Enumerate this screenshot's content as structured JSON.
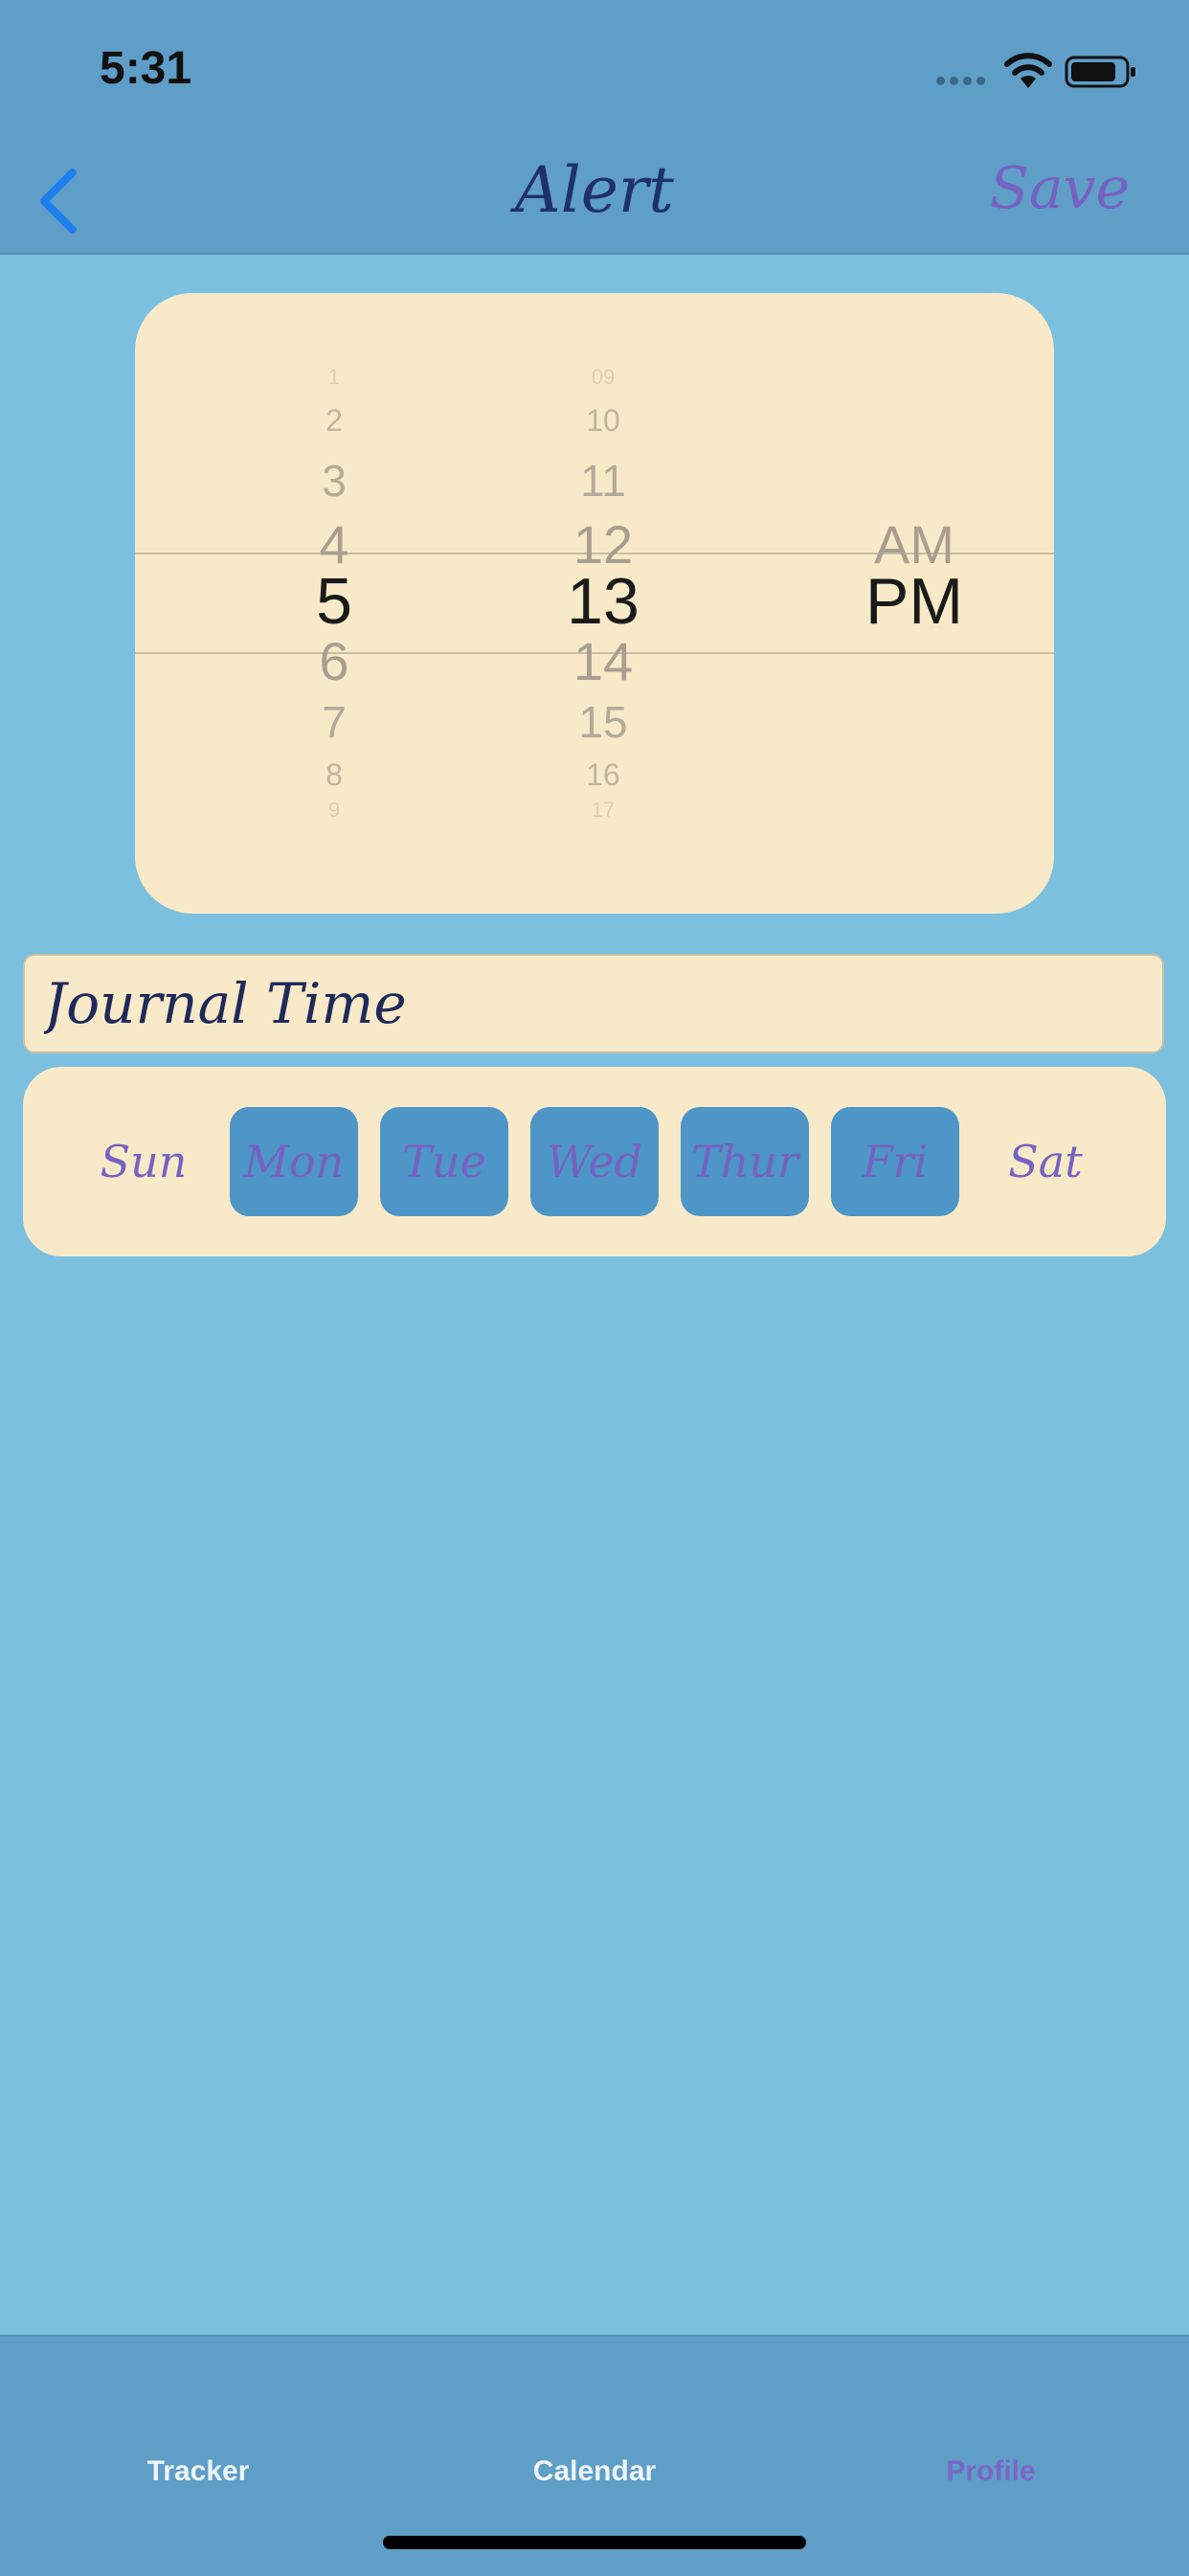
{
  "status": {
    "time": "5:31"
  },
  "nav": {
    "title": "Alert",
    "save_label": "Save"
  },
  "picker": {
    "hours": [
      "1",
      "2",
      "3",
      "4",
      "5",
      "6",
      "7",
      "8",
      "9"
    ],
    "selected_hour": "5",
    "minutes": [
      "09",
      "10",
      "11",
      "12",
      "13",
      "14",
      "15",
      "16",
      "17"
    ],
    "selected_minute": "13",
    "periods": [
      "AM",
      "PM"
    ],
    "selected_period": "PM"
  },
  "alert": {
    "title_value": "Journal Time"
  },
  "days": [
    {
      "label": "Sun",
      "selected": false
    },
    {
      "label": "Mon",
      "selected": true
    },
    {
      "label": "Tue",
      "selected": true
    },
    {
      "label": "Wed",
      "selected": true
    },
    {
      "label": "Thur",
      "selected": true
    },
    {
      "label": "Fri",
      "selected": true
    },
    {
      "label": "Sat",
      "selected": false
    }
  ],
  "tabs": [
    {
      "label": "Tracker",
      "active": false
    },
    {
      "label": "Calendar",
      "active": false
    },
    {
      "label": "Profile",
      "active": true
    }
  ],
  "colors": {
    "background": "#7bc0de",
    "bar": "#5e9ec7",
    "cream": "#f8eac8",
    "accent": "#7662c2",
    "day_selected": "#4e95c8",
    "back_chevron": "#1e7ef0"
  }
}
